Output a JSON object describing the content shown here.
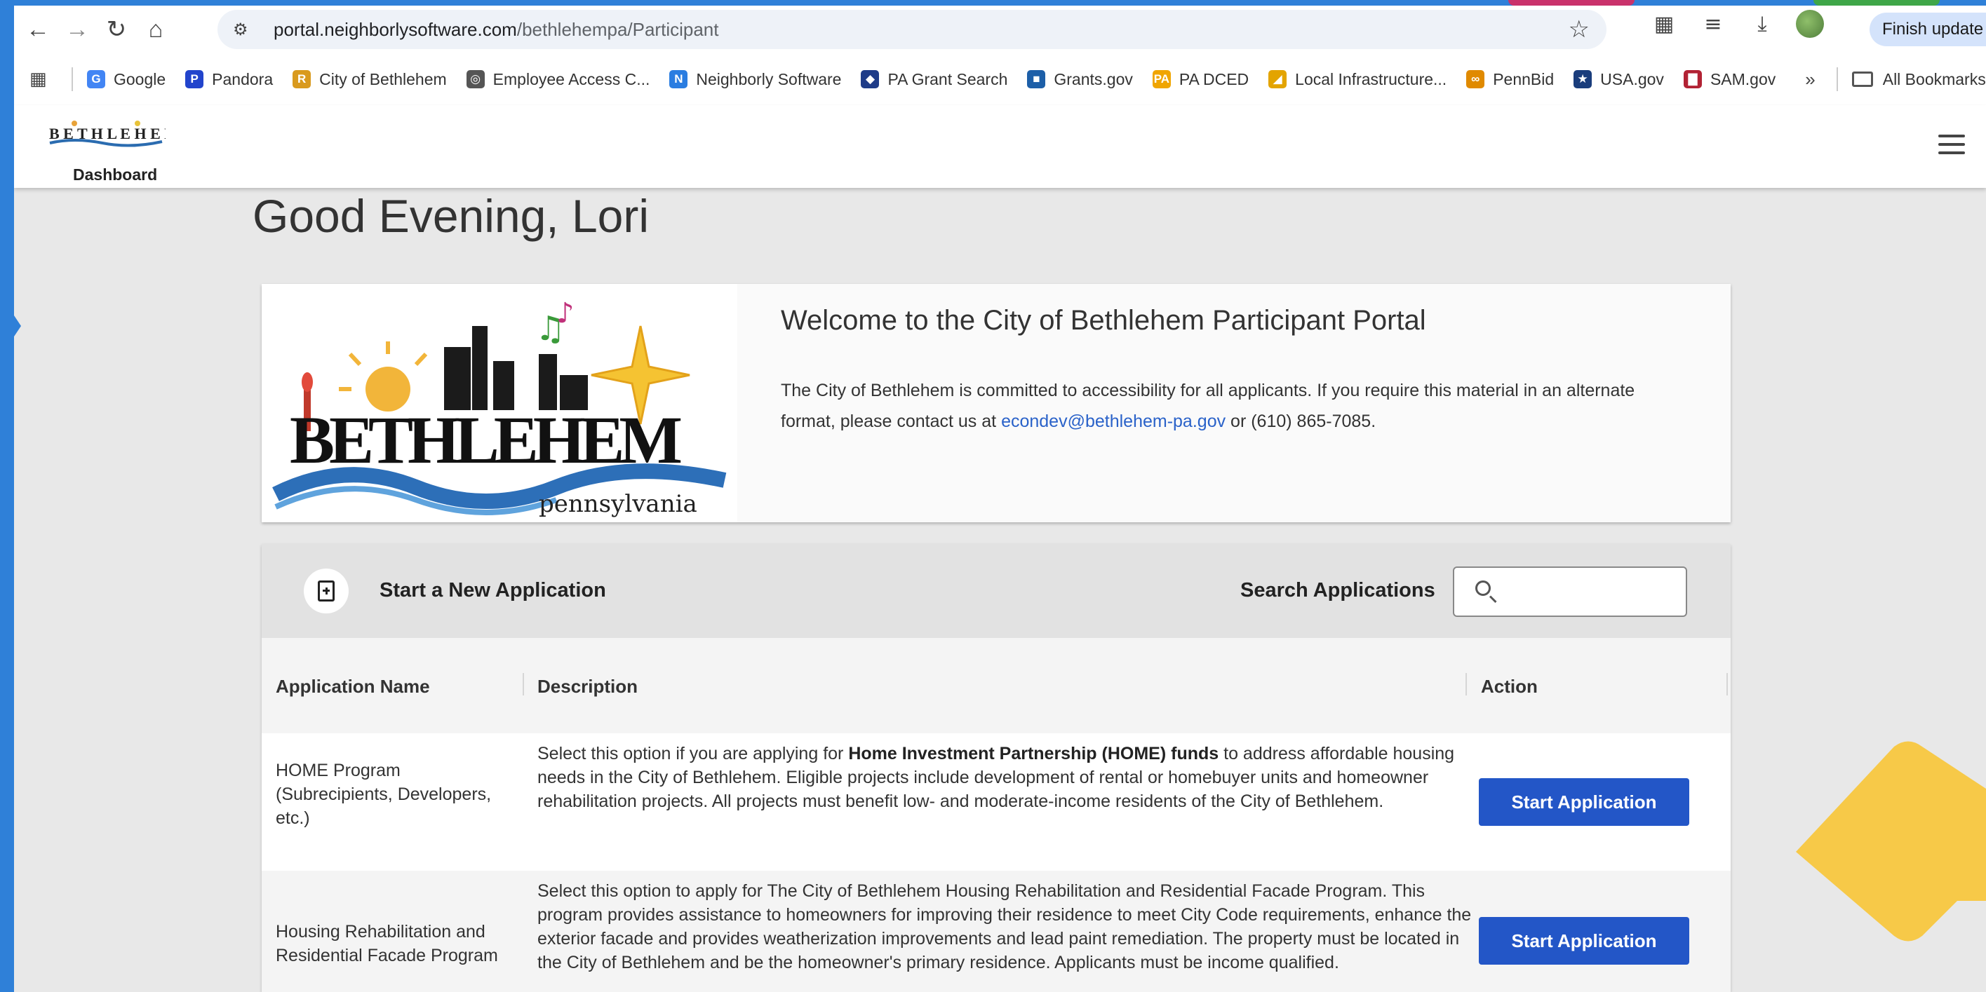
{
  "browser": {
    "url_host": "portal.neighborlysoftware.com",
    "url_path": "/bethlehempa/Participant",
    "finish_update": "Finish update",
    "bookmarks": [
      {
        "label": "Google",
        "icon": "G",
        "color": "#4285f4"
      },
      {
        "label": "Pandora",
        "icon": "P",
        "color": "#2244cc"
      },
      {
        "label": "City of Bethlehem",
        "icon": "R",
        "color": "#d99a1e"
      },
      {
        "label": "Employee Access C...",
        "icon": "◎",
        "color": "#555555"
      },
      {
        "label": "Neighborly Software",
        "icon": "N",
        "color": "#2a7de1"
      },
      {
        "label": "PA Grant Search",
        "icon": "◆",
        "color": "#1f3c88"
      },
      {
        "label": "Grants.gov",
        "icon": "■",
        "color": "#1d5fa8"
      },
      {
        "label": "PA DCED",
        "icon": "PA",
        "color": "#f0a500"
      },
      {
        "label": "Local Infrastructure...",
        "icon": "◢",
        "color": "#e3a400"
      },
      {
        "label": "PennBid",
        "icon": "∞",
        "color": "#e08a00"
      },
      {
        "label": "USA.gov",
        "icon": "★",
        "color": "#1a3d7c"
      },
      {
        "label": "SAM.gov",
        "icon": "▇",
        "color": "#b22234"
      }
    ],
    "all_bookmarks": "All Bookmarks"
  },
  "header": {
    "dashboard": "Dashboard"
  },
  "greeting": "Good Evening, Lori",
  "welcome": {
    "title": "Welcome to the City of Bethlehem Participant Portal",
    "text_before": "The City of Bethlehem is committed to accessibility for all applicants. If you require this material in an alternate format, please contact us at ",
    "email": "econdev@bethlehem-pa.gov",
    "text_after": " or (610) 865-7085.",
    "logo_word": "BETHLEHEM",
    "logo_sub": "pennsylvania"
  },
  "applications": {
    "new_label": "Start a New Application",
    "search_label": "Search Applications",
    "search_placeholder": "",
    "columns": {
      "name": "Application Name",
      "description": "Description",
      "action": "Action"
    },
    "rows": [
      {
        "name": "HOME Program (Subrecipients, Developers, etc.)",
        "desc_before": "Select this option if you are applying for ",
        "desc_bold": "Home Investment Partnership (HOME) funds",
        "desc_after": " to address affordable housing needs in the City of Bethlehem. Eligible projects include development of rental or homebuyer units and homeowner rehabilitation projects. All projects must benefit low- and moderate-income residents of the City of Bethlehem.",
        "button": "Start Application"
      },
      {
        "name": "Housing Rehabilitation and Residential Facade Program",
        "desc_before": "Select this option to apply for The City of Bethlehem Housing Rehabilitation and Residential Facade Program. This program provides assistance to homeowners for improving their residence to meet City Code requirements, enhance the exterior facade and provides weatherization improvements and lead paint remediation. The property must be located in the City of Bethlehem and be the homeowner's primary residence. Applicants must be income qualified.",
        "desc_bold": "",
        "desc_after": "",
        "button": "Start Application"
      }
    ]
  },
  "colors": {
    "frame": "#2f80d8",
    "button": "#2356c7",
    "arrow": "#f7c948",
    "link": "#2a62c9"
  }
}
